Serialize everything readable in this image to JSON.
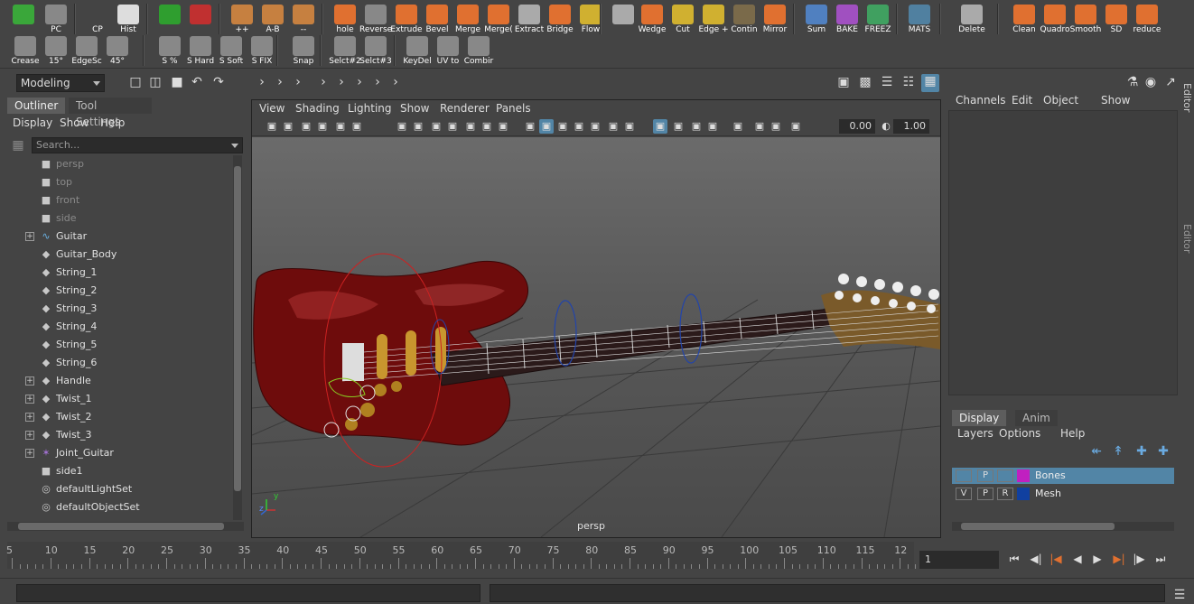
{
  "shelf": {
    "row1": [
      {
        "label": "",
        "icon": "refresh-icon",
        "color": "#3aa73a"
      },
      {
        "label": "PC",
        "icon": "camera-icon",
        "color": "#888888"
      },
      {
        "label": "CP",
        "icon": "pivot-icon",
        "color": "#444444"
      },
      {
        "label": "Hist",
        "icon": "history-icon",
        "color": "#dddddd"
      },
      {
        "label": "",
        "icon": "green-sphere-icon",
        "color": "#2f9e2f"
      },
      {
        "label": "",
        "icon": "red-sphere-icon",
        "color": "#c03030"
      },
      {
        "label": "++",
        "icon": "combine-icon",
        "color": "#c68040"
      },
      {
        "label": "A-B",
        "icon": "boolean-icon",
        "color": "#c68040"
      },
      {
        "label": "--",
        "icon": "subtract-icon",
        "color": "#c68040"
      },
      {
        "label": "hole",
        "icon": "hole-icon",
        "color": "#e07030"
      },
      {
        "label": "Reverse",
        "icon": "reverse-icon",
        "color": "#888888"
      },
      {
        "label": "Extrude",
        "icon": "extrude-icon",
        "color": "#e07030"
      },
      {
        "label": "Bevel",
        "icon": "bevel-icon",
        "color": "#e07030"
      },
      {
        "label": "Merge",
        "icon": "merge-icon",
        "color": "#e07030"
      },
      {
        "label": "Merge(",
        "icon": "merge-center-icon",
        "color": "#e07030"
      },
      {
        "label": "Extract",
        "icon": "extract-icon",
        "color": "#aaaaaa"
      },
      {
        "label": "Bridge",
        "icon": "bridge-icon",
        "color": "#e07030"
      },
      {
        "label": "Flow",
        "icon": "flow-icon",
        "color": "#d0b030"
      },
      {
        "label": "",
        "icon": "transform-icon",
        "color": "#aaaaaa"
      },
      {
        "label": "Wedge",
        "icon": "wedge-icon",
        "color": "#e07030"
      },
      {
        "label": "Cut",
        "icon": "cut-icon",
        "color": "#d0b030"
      },
      {
        "label": "Edge +",
        "icon": "edge-loop-icon",
        "color": "#d0b030"
      },
      {
        "label": "Contin",
        "icon": "continue-icon",
        "color": "#7a6a4a"
      },
      {
        "label": "Mirror",
        "icon": "mirror-icon",
        "color": "#e07030"
      },
      {
        "label": "Sum",
        "icon": "sum-icon",
        "color": "#5080c0"
      },
      {
        "label": "BAKE",
        "icon": "bake-icon",
        "color": "#a050c0"
      },
      {
        "label": "FREEZ",
        "icon": "freeze-icon",
        "color": "#40a060"
      },
      {
        "label": "MATS",
        "icon": "materials-icon",
        "color": "#5080a0"
      },
      {
        "label": "Delete",
        "icon": "trash-icon",
        "color": "#aaaaaa"
      },
      {
        "label": "Clean",
        "icon": "clean-icon",
        "color": "#e07030"
      },
      {
        "label": "Quadro",
        "icon": "quadro-icon",
        "color": "#e07030"
      },
      {
        "label": "Smooth",
        "icon": "smooth-icon",
        "color": "#e07030"
      },
      {
        "label": "SD",
        "icon": "subdivide-icon",
        "color": "#e07030"
      },
      {
        "label": "reduce",
        "icon": "reduce-icon",
        "color": "#e07030"
      }
    ],
    "row2": [
      {
        "label": "Crease",
        "icon": "crease-icon",
        "color": "#888888"
      },
      {
        "label": "15°",
        "icon": "angle-15-icon",
        "color": "#888888"
      },
      {
        "label": "EdgeSc",
        "icon": "edge-scale-icon",
        "color": "#888888"
      },
      {
        "label": "45°",
        "icon": "angle-45-icon",
        "color": "#888888"
      },
      {
        "label": "S %",
        "icon": "soft-percent-icon",
        "color": "#888888"
      },
      {
        "label": "S Hard",
        "icon": "soft-hard-icon",
        "color": "#888888"
      },
      {
        "label": "S Soft",
        "icon": "soft-soft-icon",
        "color": "#888888"
      },
      {
        "label": "S FIX",
        "icon": "soft-fix-icon",
        "color": "#888888"
      },
      {
        "label": "Snap",
        "icon": "snap-icon",
        "color": "#888888"
      },
      {
        "label": "Selct#2",
        "icon": "select-2-icon",
        "color": "#888888"
      },
      {
        "label": "Selct#3",
        "icon": "select-3-icon",
        "color": "#888888"
      },
      {
        "label": "KeyDel",
        "icon": "key-delete-icon",
        "color": "#888888"
      },
      {
        "label": "UV to",
        "icon": "uv-icon",
        "color": "#888888"
      },
      {
        "label": "Combir",
        "icon": "combine-uv-icon",
        "color": "#888888"
      }
    ]
  },
  "toolbar": {
    "mode": "Modeling"
  },
  "outliner": {
    "tabs": [
      "Outliner",
      "Tool Settings"
    ],
    "menu": [
      "Display",
      "Show",
      "Help"
    ],
    "search_placeholder": "Search...",
    "items": [
      {
        "name": "persp",
        "icon": "camera-icon",
        "expand": false,
        "dim": true
      },
      {
        "name": "top",
        "icon": "camera-icon",
        "expand": false,
        "dim": true
      },
      {
        "name": "front",
        "icon": "camera-icon",
        "expand": false,
        "dim": true
      },
      {
        "name": "side",
        "icon": "camera-icon",
        "expand": false,
        "dim": true
      },
      {
        "name": "Guitar",
        "icon": "curve-icon",
        "expand": true,
        "dim": false
      },
      {
        "name": "Guitar_Body",
        "icon": "mesh-icon",
        "expand": false,
        "dim": false
      },
      {
        "name": "String_1",
        "icon": "mesh-icon",
        "expand": false,
        "dim": false
      },
      {
        "name": "String_2",
        "icon": "mesh-icon",
        "expand": false,
        "dim": false
      },
      {
        "name": "String_3",
        "icon": "mesh-icon",
        "expand": false,
        "dim": false
      },
      {
        "name": "String_4",
        "icon": "mesh-icon",
        "expand": false,
        "dim": false
      },
      {
        "name": "String_5",
        "icon": "mesh-icon",
        "expand": false,
        "dim": false
      },
      {
        "name": "String_6",
        "icon": "mesh-icon",
        "expand": false,
        "dim": false
      },
      {
        "name": "Handle",
        "icon": "mesh-icon",
        "expand": true,
        "dim": false
      },
      {
        "name": "Twist_1",
        "icon": "mesh-icon",
        "expand": true,
        "dim": false
      },
      {
        "name": "Twist_2",
        "icon": "mesh-icon",
        "expand": true,
        "dim": false
      },
      {
        "name": "Twist_3",
        "icon": "mesh-icon",
        "expand": true,
        "dim": false
      },
      {
        "name": "Joint_Guitar",
        "icon": "joint-icon",
        "expand": true,
        "dim": false
      },
      {
        "name": "side1",
        "icon": "camera-icon",
        "expand": false,
        "dim": false
      },
      {
        "name": "defaultLightSet",
        "icon": "set-icon",
        "expand": false,
        "dim": false
      },
      {
        "name": "defaultObjectSet",
        "icon": "set-icon",
        "expand": false,
        "dim": false
      }
    ]
  },
  "viewport": {
    "menu": [
      "View",
      "Shading",
      "Lighting",
      "Show",
      "Renderer",
      "Panels"
    ],
    "exposure": "0.00",
    "gamma": "1.00",
    "camera_label": "persp",
    "axis_y": "y",
    "axis_z": "z"
  },
  "channel_box": {
    "menu": [
      "Channels",
      "Edit",
      "Object",
      "Show"
    ],
    "side_tab_1": "Channel Box / Layer Editor",
    "side_tab_2": "Attribute Editor"
  },
  "layer_editor": {
    "tabs": [
      "Display",
      "Anim"
    ],
    "menu": [
      "Layers",
      "Options",
      "Help"
    ],
    "layers": [
      {
        "v": "",
        "p": "P",
        "r": "",
        "name": "Bones",
        "color": "#c020c0",
        "selected": true
      },
      {
        "v": "V",
        "p": "P",
        "r": "R",
        "name": "Mesh",
        "color": "#1040a0",
        "selected": false
      }
    ]
  },
  "timeline": {
    "ticks": [
      "5",
      "10",
      "15",
      "20",
      "25",
      "30",
      "35",
      "40",
      "45",
      "50",
      "55",
      "60",
      "65",
      "70",
      "75",
      "80",
      "85",
      "90",
      "95",
      "100",
      "105",
      "110",
      "115",
      "12"
    ],
    "current_frame": "1"
  }
}
